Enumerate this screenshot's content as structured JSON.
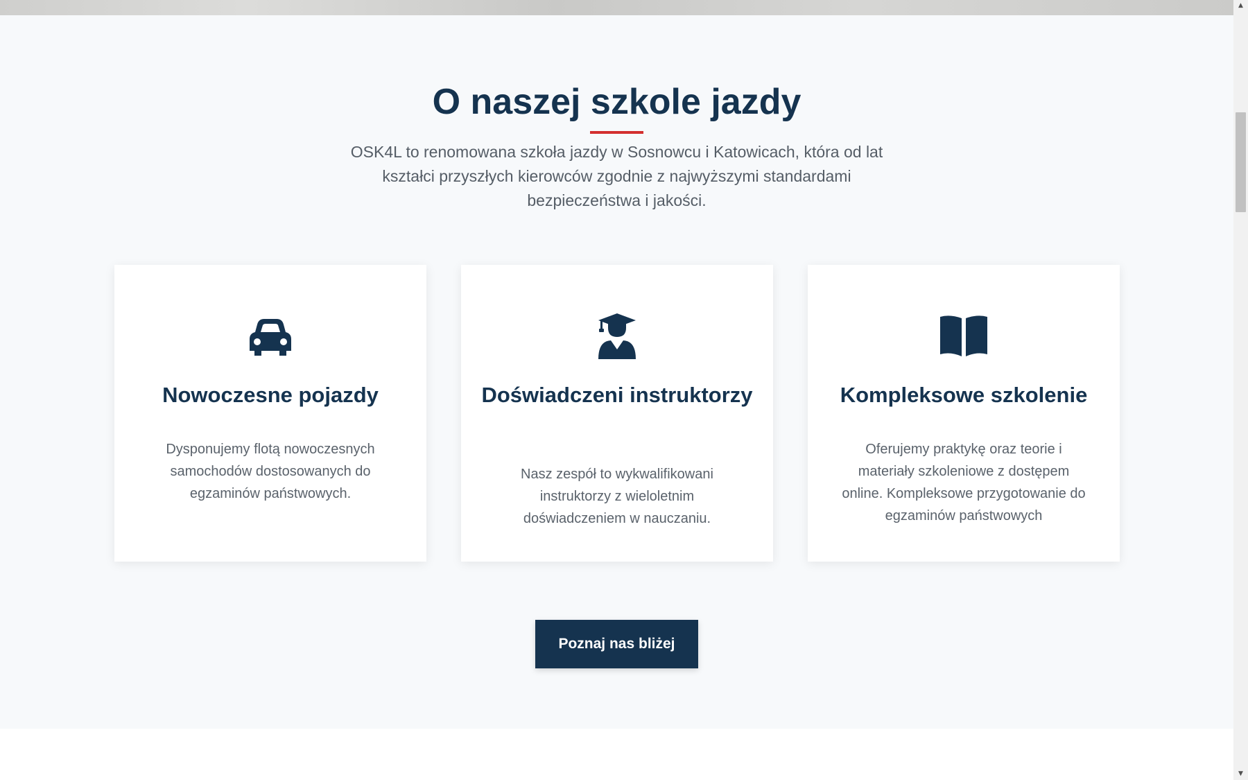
{
  "about": {
    "title": "O naszej szkole jazdy",
    "intro": "OSK4L to renomowana szkoła jazdy w Sosnowcu i Katowicach, która od lat kształci przyszłych kierowców zgodnie z najwyższymi standardami bezpieczeństwa i jakości.",
    "cards": [
      {
        "icon": "car-icon",
        "title": "Nowoczesne pojazdy",
        "description": "Dysponujemy flotą nowoczesnych samochodów dostosowanych do egzaminów państwowych."
      },
      {
        "icon": "graduate-icon",
        "title": "Doświadczeni instruktorzy",
        "description": "Nasz zespół to wykwalifikowani instruktorzy z wieloletnim doświadczeniem w nauczaniu."
      },
      {
        "icon": "book-icon",
        "title": "Kompleksowe szkolenie",
        "description": "Oferujemy praktykę oraz teorie i materiały szkoleniowe z dostępem online. Kompleksowe przygotowanie do egzaminów państwowych"
      }
    ],
    "cta_label": "Poznaj nas bliżej"
  },
  "colors": {
    "primary": "#15334f",
    "accent": "#d32f2f",
    "section_background": "#f7f9fb",
    "text_muted": "#5a626b"
  }
}
